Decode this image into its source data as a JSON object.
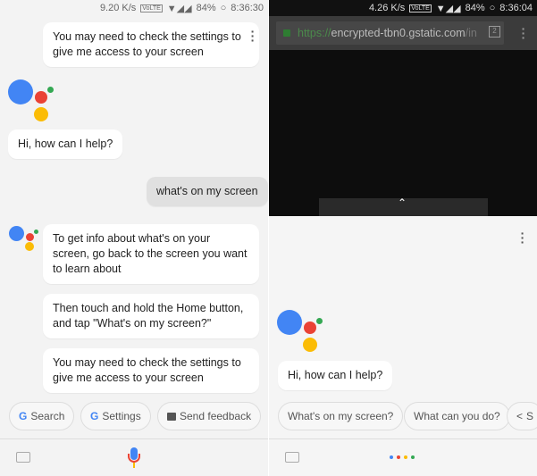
{
  "left": {
    "status": {
      "speed": "9.20 K/s",
      "volte": "VoLTE",
      "battery": "84%",
      "time": "8:36:30"
    },
    "messages": [
      {
        "from": "assistant",
        "text": "You may need to check the settings to give me access to your screen"
      },
      {
        "from": "assistant",
        "text": "Hi, how can I help?"
      },
      {
        "from": "user",
        "text": "what's on my screen"
      },
      {
        "from": "assistant",
        "text": "To get info about what's on your screen, go back to the screen you want to learn about"
      },
      {
        "from": "assistant",
        "text": "Then touch and hold the Home button, and tap \"What's on my screen?\""
      },
      {
        "from": "assistant",
        "text": "You may need to check the settings to give me access to your screen"
      }
    ],
    "chips": [
      {
        "icon": "google-g-icon",
        "label": "Search"
      },
      {
        "icon": "google-g-icon",
        "label": "Settings"
      },
      {
        "icon": "feedback-icon",
        "label": "Send feedback"
      }
    ]
  },
  "right": {
    "status": {
      "speed": "4.26 K/s",
      "volte": "VoLTE",
      "battery": "84%",
      "time": "8:36:04"
    },
    "url": {
      "scheme": "https://",
      "host": "encrypted-tbn0.gstatic.com",
      "path": "/in"
    },
    "tab_count": "2",
    "greeting": "Hi, how can I help?",
    "chips": [
      {
        "label": "What's on my screen?"
      },
      {
        "label": "What can you do?"
      },
      {
        "icon": "share-icon",
        "label": "S"
      }
    ]
  },
  "colors": {
    "blue": "#4285f4",
    "red": "#ea4335",
    "yellow": "#fbbc05",
    "green": "#34a853"
  }
}
